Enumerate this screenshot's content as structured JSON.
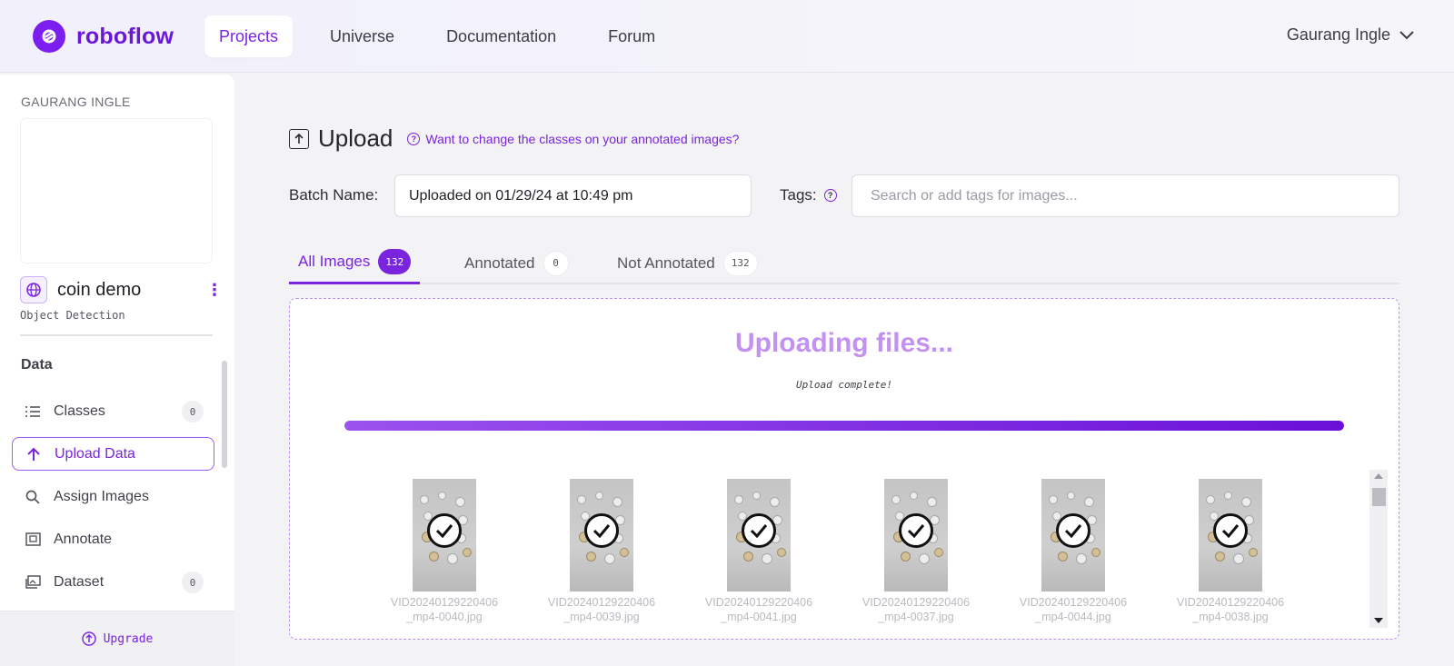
{
  "brand": {
    "name": "roboflow",
    "accent": "#7a24e0"
  },
  "nav": {
    "items": [
      {
        "label": "Projects",
        "active": true
      },
      {
        "label": "Universe",
        "active": false
      },
      {
        "label": "Documentation",
        "active": false
      },
      {
        "label": "Forum",
        "active": false
      }
    ],
    "user": "Gaurang Ingle"
  },
  "sidebar": {
    "workspace": "GAURANG INGLE",
    "project": {
      "name": "coin demo",
      "type": "Object Detection"
    },
    "section": "Data",
    "items": [
      {
        "label": "Classes",
        "icon": "list-icon",
        "count": "0"
      },
      {
        "label": "Upload Data",
        "icon": "arrow-up-icon",
        "active": true
      },
      {
        "label": "Assign Images",
        "icon": "search-icon"
      },
      {
        "label": "Annotate",
        "icon": "annotate-icon"
      },
      {
        "label": "Dataset",
        "icon": "images-icon",
        "count": "0"
      }
    ],
    "upgrade": "Upgrade"
  },
  "main": {
    "title": "Upload",
    "help_link": "Want to change the classes on your annotated images?",
    "batch_label": "Batch Name:",
    "batch_value": "Uploaded on 01/29/24 at 10:49 pm",
    "tags_label": "Tags:",
    "tags_placeholder": "Search or add tags for images...",
    "tabs": [
      {
        "label": "All Images",
        "count": "132",
        "active": true
      },
      {
        "label": "Annotated",
        "count": "0"
      },
      {
        "label": "Not Annotated",
        "count": "132"
      }
    ],
    "upload": {
      "heading": "Uploading files...",
      "status": "Upload complete!",
      "progress": 1.0
    },
    "files": [
      {
        "line1": "VID20240129220406",
        "line2": "_mp4-0040.jpg"
      },
      {
        "line1": "VID20240129220406",
        "line2": "_mp4-0039.jpg"
      },
      {
        "line1": "VID20240129220406",
        "line2": "_mp4-0041.jpg"
      },
      {
        "line1": "VID20240129220406",
        "line2": "_mp4-0037.jpg"
      },
      {
        "line1": "VID20240129220406",
        "line2": "_mp4-0044.jpg"
      },
      {
        "line1": "VID20240129220406",
        "line2": "_mp4-0038.jpg"
      }
    ]
  }
}
